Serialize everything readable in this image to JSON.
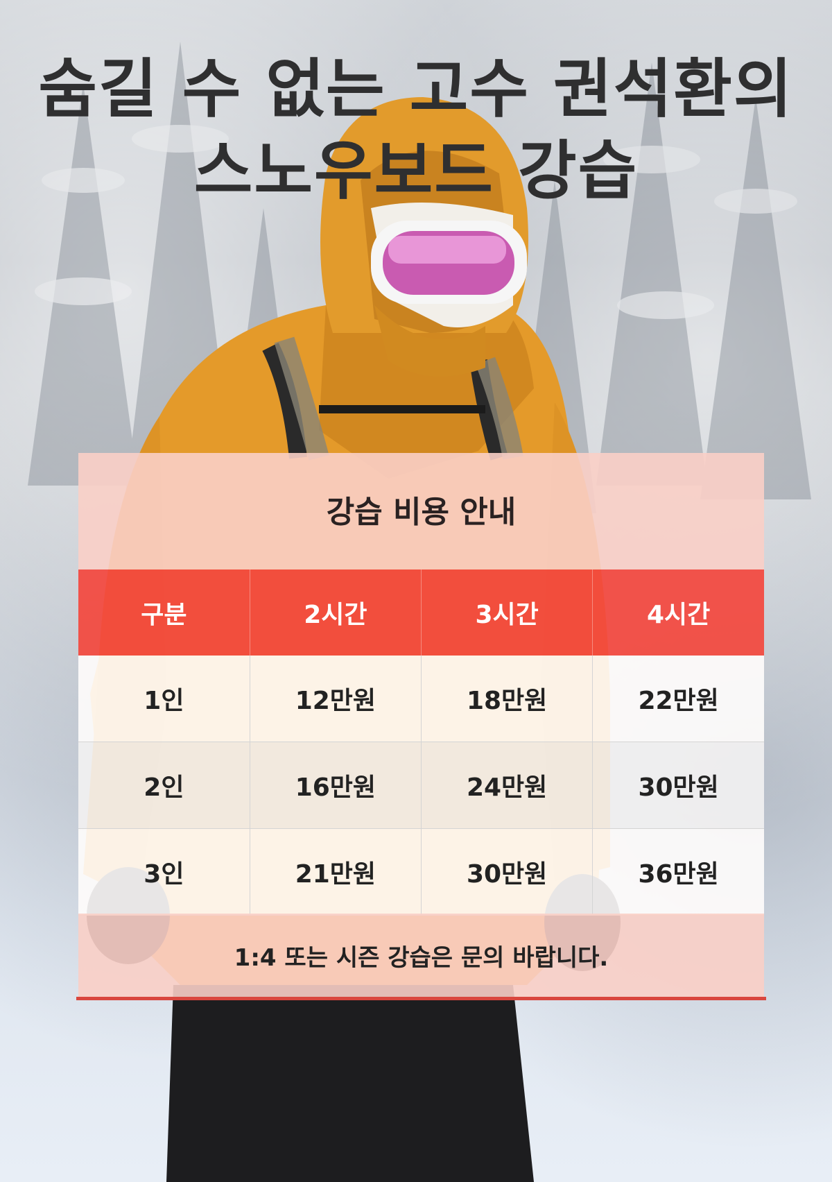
{
  "poster": {
    "title_line1": "숨길 수 없는 고수 권석환의",
    "title_line2": "스노우보드 강습"
  },
  "pricing": {
    "heading": "강습 비용 안내",
    "columns": [
      "구분",
      "2시간",
      "3시간",
      "4시간"
    ],
    "rows": [
      [
        "1인",
        "12만원",
        "18만원",
        "22만원"
      ],
      [
        "2인",
        "16만원",
        "24만원",
        "30만원"
      ],
      [
        "3인",
        "21만원",
        "30만원",
        "36만원"
      ]
    ],
    "note": "1:4 또는 시즌 강습은 문의 바랍니다."
  },
  "colors": {
    "header_row": "#f3483e",
    "panel_pink": "#f9cfc6",
    "accent_line": "#d9463e",
    "title_text": "#2f2f30",
    "jacket": "#e49a2a"
  }
}
